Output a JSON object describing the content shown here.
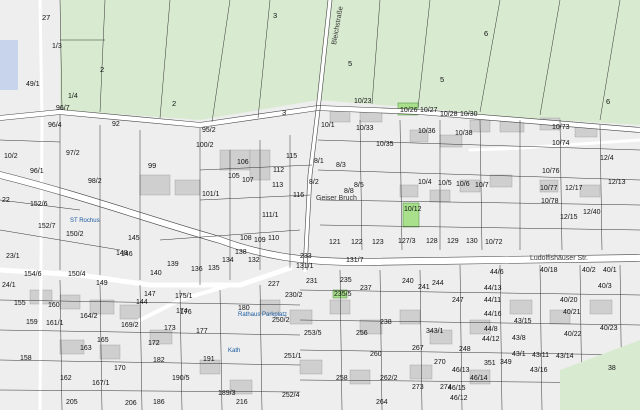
{
  "colors": {
    "field": "#d8ebd0",
    "urban": "#eeeeee",
    "building": "#cfcfcf",
    "road": "#ffffff",
    "line": "#333333",
    "highlight_green": "#a8e08c",
    "poi_blue": "#1a5aa0",
    "urban_block_blue": "#c8d4ec"
  },
  "streets": {
    "top_road": "Bleichstraße",
    "mid_road": "Geiser Bruch",
    "main_road": "Ludolfishäuser Str."
  },
  "pois": [
    {
      "id": "p1",
      "label": "ST Rochus"
    },
    {
      "id": "p2",
      "label": "Kath"
    },
    {
      "id": "p3",
      "label": "Rathaus Parkplatz"
    }
  ],
  "parcels": [
    {
      "id": "a",
      "label": "27"
    },
    {
      "id": "b",
      "label": "3"
    },
    {
      "id": "c",
      "label": "5"
    },
    {
      "id": "d",
      "label": "6"
    },
    {
      "id": "e",
      "label": "1/3"
    },
    {
      "id": "f",
      "label": "1/4"
    },
    {
      "id": "g",
      "label": "2"
    },
    {
      "id": "h",
      "label": "2"
    },
    {
      "id": "i",
      "label": "3"
    },
    {
      "id": "j",
      "label": "5"
    },
    {
      "id": "k",
      "label": "6"
    },
    {
      "id": "l",
      "label": "96/4"
    },
    {
      "id": "m",
      "label": "96/7"
    },
    {
      "id": "n",
      "label": "92"
    },
    {
      "id": "o",
      "label": "97/2"
    },
    {
      "id": "p",
      "label": "98/2"
    },
    {
      "id": "q",
      "label": "99"
    },
    {
      "id": "r",
      "label": "95/2"
    },
    {
      "id": "s",
      "label": "100/2"
    },
    {
      "id": "t",
      "label": "101/1"
    },
    {
      "id": "u",
      "label": "115"
    },
    {
      "id": "v",
      "label": "116"
    },
    {
      "id": "w",
      "label": "113"
    },
    {
      "id": "x",
      "label": "112"
    },
    {
      "id": "y",
      "label": "111/1"
    },
    {
      "id": "z",
      "label": "110"
    },
    {
      "id": "aa",
      "label": "109"
    },
    {
      "id": "ab",
      "label": "108"
    },
    {
      "id": "ac",
      "label": "107"
    },
    {
      "id": "ad",
      "label": "106"
    },
    {
      "id": "ae",
      "label": "105"
    },
    {
      "id": "af",
      "label": "8/1"
    },
    {
      "id": "ag",
      "label": "8/2"
    },
    {
      "id": "ah",
      "label": "8/3"
    },
    {
      "id": "ai",
      "label": "8/5"
    },
    {
      "id": "aj",
      "label": "8/8"
    },
    {
      "id": "ak",
      "label": "10/1"
    },
    {
      "id": "al",
      "label": "10/23"
    },
    {
      "id": "am",
      "label": "10/26"
    },
    {
      "id": "an",
      "label": "10/27"
    },
    {
      "id": "ao",
      "label": "10/28"
    },
    {
      "id": "ap",
      "label": "10/30"
    },
    {
      "id": "aq",
      "label": "10/33"
    },
    {
      "id": "ar",
      "label": "10/35"
    },
    {
      "id": "as",
      "label": "10/36"
    },
    {
      "id": "at",
      "label": "10/38"
    },
    {
      "id": "au",
      "label": "10/4"
    },
    {
      "id": "av",
      "label": "10/5"
    },
    {
      "id": "aw",
      "label": "10/6"
    },
    {
      "id": "ax",
      "label": "10/7"
    },
    {
      "id": "ay",
      "label": "10/12"
    },
    {
      "id": "az",
      "label": "10/72"
    },
    {
      "id": "ba",
      "label": "10/73"
    },
    {
      "id": "bb",
      "label": "10/74"
    },
    {
      "id": "bc",
      "label": "10/76"
    },
    {
      "id": "bd",
      "label": "10/77"
    },
    {
      "id": "be",
      "label": "10/78"
    },
    {
      "id": "bf",
      "label": "12/15"
    },
    {
      "id": "bg",
      "label": "12/17"
    },
    {
      "id": "bh",
      "label": "12/13"
    },
    {
      "id": "bi",
      "label": "12/40"
    },
    {
      "id": "bj",
      "label": "12/4"
    },
    {
      "id": "bk",
      "label": "121"
    },
    {
      "id": "bl",
      "label": "122"
    },
    {
      "id": "bm",
      "label": "123"
    },
    {
      "id": "bn",
      "label": "127/3"
    },
    {
      "id": "bo",
      "label": "128"
    },
    {
      "id": "bp",
      "label": "129"
    },
    {
      "id": "bq",
      "label": "130"
    },
    {
      "id": "br",
      "label": "131/7"
    },
    {
      "id": "bs",
      "label": "131/1"
    },
    {
      "id": "bt",
      "label": "132"
    },
    {
      "id": "bu",
      "label": "134"
    },
    {
      "id": "bv",
      "label": "135"
    },
    {
      "id": "bw",
      "label": "136"
    },
    {
      "id": "bx",
      "label": "138"
    },
    {
      "id": "by",
      "label": "139"
    },
    {
      "id": "bz",
      "label": "140"
    },
    {
      "id": "ca",
      "label": "144"
    },
    {
      "id": "cb",
      "label": "145"
    },
    {
      "id": "cc",
      "label": "146"
    },
    {
      "id": "cd",
      "label": "147"
    },
    {
      "id": "ce",
      "label": "148"
    },
    {
      "id": "cf",
      "label": "149"
    },
    {
      "id": "cg",
      "label": "150/2"
    },
    {
      "id": "ch",
      "label": "150/4"
    },
    {
      "id": "ci",
      "label": "152/6"
    },
    {
      "id": "cj",
      "label": "152/7"
    },
    {
      "id": "ck",
      "label": "154/6"
    },
    {
      "id": "cl",
      "label": "155"
    },
    {
      "id": "cm",
      "label": "158"
    },
    {
      "id": "cn",
      "label": "159"
    },
    {
      "id": "co",
      "label": "160"
    },
    {
      "id": "cp",
      "label": "161/1"
    },
    {
      "id": "cq",
      "label": "162"
    },
    {
      "id": "cr",
      "label": "163"
    },
    {
      "id": "cs",
      "label": "164/2"
    },
    {
      "id": "ct",
      "label": "165"
    },
    {
      "id": "cu",
      "label": "167/1"
    },
    {
      "id": "cv",
      "label": "169/2"
    },
    {
      "id": "cw",
      "label": "170"
    },
    {
      "id": "cx",
      "label": "172"
    },
    {
      "id": "cy",
      "label": "173"
    },
    {
      "id": "cz",
      "label": "174"
    },
    {
      "id": "da",
      "label": "175/1"
    },
    {
      "id": "db",
      "label": "176"
    },
    {
      "id": "dc",
      "label": "177"
    },
    {
      "id": "dd",
      "label": "180"
    },
    {
      "id": "de",
      "label": "182"
    },
    {
      "id": "df",
      "label": "186"
    },
    {
      "id": "dg",
      "label": "189/3"
    },
    {
      "id": "dh",
      "label": "190/5"
    },
    {
      "id": "di",
      "label": "191"
    },
    {
      "id": "dj",
      "label": "205"
    },
    {
      "id": "dk",
      "label": "206"
    },
    {
      "id": "dl",
      "label": "216"
    },
    {
      "id": "dm",
      "label": "227"
    },
    {
      "id": "dn",
      "label": "230/2"
    },
    {
      "id": "do",
      "label": "231"
    },
    {
      "id": "dp",
      "label": "233"
    },
    {
      "id": "dq",
      "label": "235"
    },
    {
      "id": "dr",
      "label": "235/5"
    },
    {
      "id": "ds",
      "label": "237"
    },
    {
      "id": "dt",
      "label": "238"
    },
    {
      "id": "du",
      "label": "240"
    },
    {
      "id": "dv",
      "label": "241"
    },
    {
      "id": "dw",
      "label": "244"
    },
    {
      "id": "dx",
      "label": "247"
    },
    {
      "id": "dy",
      "label": "248"
    },
    {
      "id": "dz",
      "label": "250/2"
    },
    {
      "id": "ea",
      "label": "251/1"
    },
    {
      "id": "eb",
      "label": "252/4"
    },
    {
      "id": "ec",
      "label": "253/5"
    },
    {
      "id": "ed",
      "label": "256"
    },
    {
      "id": "ee",
      "label": "258"
    },
    {
      "id": "ef",
      "label": "260"
    },
    {
      "id": "eg",
      "label": "262/2"
    },
    {
      "id": "eh",
      "label": "264"
    },
    {
      "id": "ei",
      "label": "267"
    },
    {
      "id": "ej",
      "label": "270"
    },
    {
      "id": "ek",
      "label": "273"
    },
    {
      "id": "el",
      "label": "274"
    },
    {
      "id": "em",
      "label": "343/1"
    },
    {
      "id": "en",
      "label": "349"
    },
    {
      "id": "eo",
      "label": "40/2"
    },
    {
      "id": "ep",
      "label": "40/1"
    },
    {
      "id": "eq",
      "label": "40/3"
    },
    {
      "id": "er",
      "label": "40/18"
    },
    {
      "id": "es",
      "label": "40/20"
    },
    {
      "id": "et",
      "label": "40/21"
    },
    {
      "id": "eu",
      "label": "40/22"
    },
    {
      "id": "ev",
      "label": "40/23"
    },
    {
      "id": "ew",
      "label": "43/1"
    },
    {
      "id": "ex",
      "label": "43/16"
    },
    {
      "id": "ey",
      "label": "44/6"
    },
    {
      "id": "ez",
      "label": "44/11"
    },
    {
      "id": "fa",
      "label": "44/13"
    },
    {
      "id": "fb",
      "label": "44/16"
    },
    {
      "id": "fc",
      "label": "44/12"
    },
    {
      "id": "fd",
      "label": "44/8"
    },
    {
      "id": "fe",
      "label": "43/8"
    },
    {
      "id": "ff",
      "label": "43/15"
    },
    {
      "id": "fg",
      "label": "43/11"
    },
    {
      "id": "fh",
      "label": "43/14"
    },
    {
      "id": "fi",
      "label": "46/15"
    },
    {
      "id": "fj",
      "label": "46/12"
    },
    {
      "id": "fk",
      "label": "46/14"
    },
    {
      "id": "fl",
      "label": "46/13"
    },
    {
      "id": "fm",
      "label": "38"
    },
    {
      "id": "fn",
      "label": "10/2"
    },
    {
      "id": "fo",
      "label": "49/1"
    },
    {
      "id": "fp",
      "label": "22"
    },
    {
      "id": "fq",
      "label": "23/1"
    },
    {
      "id": "fr",
      "label": "24/1"
    },
    {
      "id": "fs",
      "label": "96/1"
    },
    {
      "id": "ft",
      "label": "351"
    }
  ]
}
